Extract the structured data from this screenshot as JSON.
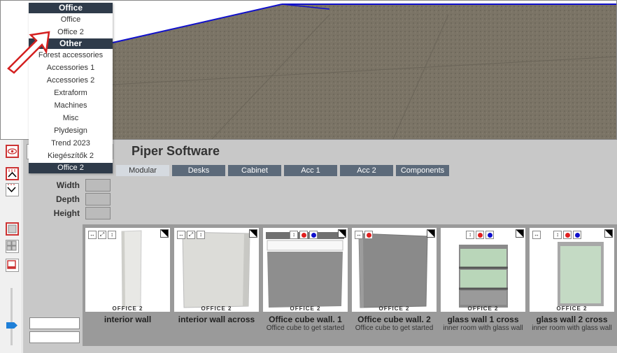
{
  "dropdown": {
    "groups": [
      {
        "header": "Office",
        "items": [
          "Office",
          "Office 2"
        ]
      },
      {
        "header": "Other",
        "items": [
          "Forest accessories",
          "Accessories 1",
          "Accessories 2",
          "Extraform",
          "Machines",
          "Misc",
          "Plydesign",
          "Trend 2023",
          "Kiegészítők 2"
        ]
      }
    ],
    "selected": "Office 2"
  },
  "header": {
    "title": "Piper Software"
  },
  "tabs": [
    "Modular",
    "Desks",
    "Cabinet",
    "Acc 1",
    "Acc 2",
    "Components"
  ],
  "active_tab": "Modular",
  "dimensions": {
    "width_label": "Width",
    "depth_label": "Depth",
    "height_label": "Height"
  },
  "cards": [
    {
      "brand": "OFFICE 2",
      "name": "interior wall",
      "desc": ""
    },
    {
      "brand": "OFFICE 2",
      "name": "interior wall across",
      "desc": ""
    },
    {
      "brand": "OFFICE 2",
      "name": "Office cube wall. 1",
      "desc": "Office cube to get started"
    },
    {
      "brand": "OFFICE 2",
      "name": "Office cube wall. 2",
      "desc": "Office cube to get started"
    },
    {
      "brand": "OFFICE 2",
      "name": "glass wall 1 cross",
      "desc": "inner room with glass wall"
    },
    {
      "brand": "OFFICE 2",
      "name": "glass wall 2 cross",
      "desc": "inner room with glass wall"
    }
  ],
  "icons": [
    "eye-icon",
    "move-up-icon",
    "move-down-icon",
    "view-single-icon",
    "view-grid-icon",
    "view-frame-icon",
    "resize-horizontal-icon",
    "resize-diagonal-icon",
    "resize-vertical-icon",
    "red-dot-icon",
    "blue-dot-icon",
    "corner-expand-icon"
  ],
  "colors": {
    "header_bg": "#2f3b4a",
    "tab_bg": "#5c6a7a",
    "floor": "#7b7466",
    "wall_edge": "#1010cc",
    "slider": "#1e7fd8"
  }
}
